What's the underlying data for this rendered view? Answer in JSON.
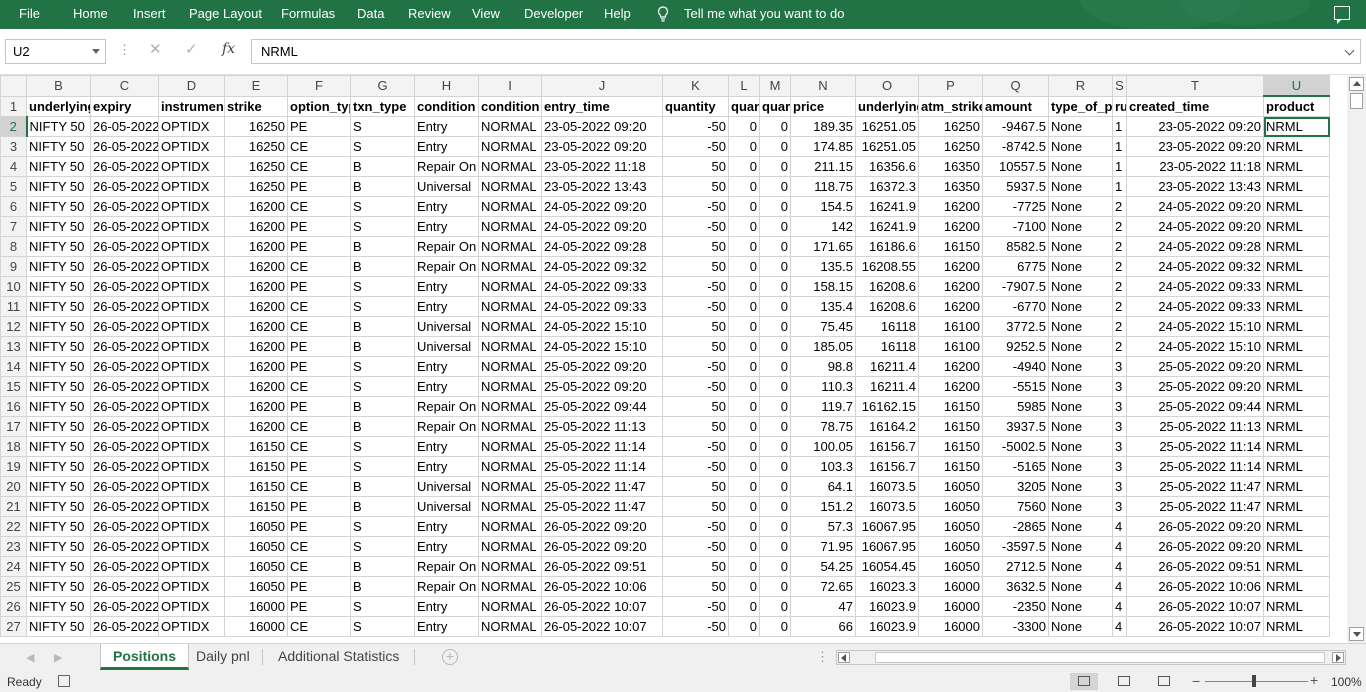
{
  "ribbon": {
    "menus": [
      "File",
      "Home",
      "Insert",
      "Page Layout",
      "Formulas",
      "Data",
      "Review",
      "View",
      "Developer",
      "Help"
    ],
    "tell_me": "Tell me what you want to do"
  },
  "formula_bar": {
    "name_box": "U2",
    "fx": "fx",
    "formula": "NRML"
  },
  "grid": {
    "columns": [
      "B",
      "C",
      "D",
      "E",
      "F",
      "G",
      "H",
      "I",
      "J",
      "K",
      "L",
      "M",
      "N",
      "O",
      "P",
      "Q",
      "R",
      "S",
      "T",
      "U"
    ],
    "selected_column": "U",
    "selected_row": "2",
    "headers": [
      "underlying",
      "expiry",
      "instrument",
      "strike",
      "option_type",
      "txn_type",
      "condition",
      "condition",
      "entry_time",
      "quantity",
      "quan",
      "quar",
      "price",
      "underlying",
      "atm_strike",
      "amount",
      "type_of_p",
      "ru",
      "created_time",
      "product"
    ],
    "rows": [
      [
        "2",
        "NIFTY 50",
        "26-05-2022",
        "OPTIDX",
        "16250",
        "PE",
        "S",
        "Entry",
        "NORMAL",
        "23-05-2022 09:20",
        "-50",
        "0",
        "0",
        "189.35",
        "16251.05",
        "16250",
        "-9467.5",
        "None",
        "1",
        "23-05-2022 09:20",
        "NRML"
      ],
      [
        "3",
        "NIFTY 50",
        "26-05-2022",
        "OPTIDX",
        "16250",
        "CE",
        "S",
        "Entry",
        "NORMAL",
        "23-05-2022 09:20",
        "-50",
        "0",
        "0",
        "174.85",
        "16251.05",
        "16250",
        "-8742.5",
        "None",
        "1",
        "23-05-2022 09:20",
        "NRML"
      ],
      [
        "4",
        "NIFTY 50",
        "26-05-2022",
        "OPTIDX",
        "16250",
        "CE",
        "B",
        "Repair On",
        "NORMAL",
        "23-05-2022 11:18",
        "50",
        "0",
        "0",
        "211.15",
        "16356.6",
        "16350",
        "10557.5",
        "None",
        "1",
        "23-05-2022 11:18",
        "NRML"
      ],
      [
        "5",
        "NIFTY 50",
        "26-05-2022",
        "OPTIDX",
        "16250",
        "PE",
        "B",
        "Universal",
        "NORMAL",
        "23-05-2022 13:43",
        "50",
        "0",
        "0",
        "118.75",
        "16372.3",
        "16350",
        "5937.5",
        "None",
        "1",
        "23-05-2022 13:43",
        "NRML"
      ],
      [
        "6",
        "NIFTY 50",
        "26-05-2022",
        "OPTIDX",
        "16200",
        "CE",
        "S",
        "Entry",
        "NORMAL",
        "24-05-2022 09:20",
        "-50",
        "0",
        "0",
        "154.5",
        "16241.9",
        "16200",
        "-7725",
        "None",
        "2",
        "24-05-2022 09:20",
        "NRML"
      ],
      [
        "7",
        "NIFTY 50",
        "26-05-2022",
        "OPTIDX",
        "16200",
        "PE",
        "S",
        "Entry",
        "NORMAL",
        "24-05-2022 09:20",
        "-50",
        "0",
        "0",
        "142",
        "16241.9",
        "16200",
        "-7100",
        "None",
        "2",
        "24-05-2022 09:20",
        "NRML"
      ],
      [
        "8",
        "NIFTY 50",
        "26-05-2022",
        "OPTIDX",
        "16200",
        "PE",
        "B",
        "Repair On",
        "NORMAL",
        "24-05-2022 09:28",
        "50",
        "0",
        "0",
        "171.65",
        "16186.6",
        "16150",
        "8582.5",
        "None",
        "2",
        "24-05-2022 09:28",
        "NRML"
      ],
      [
        "9",
        "NIFTY 50",
        "26-05-2022",
        "OPTIDX",
        "16200",
        "CE",
        "B",
        "Repair On",
        "NORMAL",
        "24-05-2022 09:32",
        "50",
        "0",
        "0",
        "135.5",
        "16208.55",
        "16200",
        "6775",
        "None",
        "2",
        "24-05-2022 09:32",
        "NRML"
      ],
      [
        "10",
        "NIFTY 50",
        "26-05-2022",
        "OPTIDX",
        "16200",
        "PE",
        "S",
        "Entry",
        "NORMAL",
        "24-05-2022 09:33",
        "-50",
        "0",
        "0",
        "158.15",
        "16208.6",
        "16200",
        "-7907.5",
        "None",
        "2",
        "24-05-2022 09:33",
        "NRML"
      ],
      [
        "11",
        "NIFTY 50",
        "26-05-2022",
        "OPTIDX",
        "16200",
        "CE",
        "S",
        "Entry",
        "NORMAL",
        "24-05-2022 09:33",
        "-50",
        "0",
        "0",
        "135.4",
        "16208.6",
        "16200",
        "-6770",
        "None",
        "2",
        "24-05-2022 09:33",
        "NRML"
      ],
      [
        "12",
        "NIFTY 50",
        "26-05-2022",
        "OPTIDX",
        "16200",
        "CE",
        "B",
        "Universal",
        "NORMAL",
        "24-05-2022 15:10",
        "50",
        "0",
        "0",
        "75.45",
        "16118",
        "16100",
        "3772.5",
        "None",
        "2",
        "24-05-2022 15:10",
        "NRML"
      ],
      [
        "13",
        "NIFTY 50",
        "26-05-2022",
        "OPTIDX",
        "16200",
        "PE",
        "B",
        "Universal",
        "NORMAL",
        "24-05-2022 15:10",
        "50",
        "0",
        "0",
        "185.05",
        "16118",
        "16100",
        "9252.5",
        "None",
        "2",
        "24-05-2022 15:10",
        "NRML"
      ],
      [
        "14",
        "NIFTY 50",
        "26-05-2022",
        "OPTIDX",
        "16200",
        "PE",
        "S",
        "Entry",
        "NORMAL",
        "25-05-2022 09:20",
        "-50",
        "0",
        "0",
        "98.8",
        "16211.4",
        "16200",
        "-4940",
        "None",
        "3",
        "25-05-2022 09:20",
        "NRML"
      ],
      [
        "15",
        "NIFTY 50",
        "26-05-2022",
        "OPTIDX",
        "16200",
        "CE",
        "S",
        "Entry",
        "NORMAL",
        "25-05-2022 09:20",
        "-50",
        "0",
        "0",
        "110.3",
        "16211.4",
        "16200",
        "-5515",
        "None",
        "3",
        "25-05-2022 09:20",
        "NRML"
      ],
      [
        "16",
        "NIFTY 50",
        "26-05-2022",
        "OPTIDX",
        "16200",
        "PE",
        "B",
        "Repair On",
        "NORMAL",
        "25-05-2022 09:44",
        "50",
        "0",
        "0",
        "119.7",
        "16162.15",
        "16150",
        "5985",
        "None",
        "3",
        "25-05-2022 09:44",
        "NRML"
      ],
      [
        "17",
        "NIFTY 50",
        "26-05-2022",
        "OPTIDX",
        "16200",
        "CE",
        "B",
        "Repair On",
        "NORMAL",
        "25-05-2022 11:13",
        "50",
        "0",
        "0",
        "78.75",
        "16164.2",
        "16150",
        "3937.5",
        "None",
        "3",
        "25-05-2022 11:13",
        "NRML"
      ],
      [
        "18",
        "NIFTY 50",
        "26-05-2022",
        "OPTIDX",
        "16150",
        "CE",
        "S",
        "Entry",
        "NORMAL",
        "25-05-2022 11:14",
        "-50",
        "0",
        "0",
        "100.05",
        "16156.7",
        "16150",
        "-5002.5",
        "None",
        "3",
        "25-05-2022 11:14",
        "NRML"
      ],
      [
        "19",
        "NIFTY 50",
        "26-05-2022",
        "OPTIDX",
        "16150",
        "PE",
        "S",
        "Entry",
        "NORMAL",
        "25-05-2022 11:14",
        "-50",
        "0",
        "0",
        "103.3",
        "16156.7",
        "16150",
        "-5165",
        "None",
        "3",
        "25-05-2022 11:14",
        "NRML"
      ],
      [
        "20",
        "NIFTY 50",
        "26-05-2022",
        "OPTIDX",
        "16150",
        "CE",
        "B",
        "Universal",
        "NORMAL",
        "25-05-2022 11:47",
        "50",
        "0",
        "0",
        "64.1",
        "16073.5",
        "16050",
        "3205",
        "None",
        "3",
        "25-05-2022 11:47",
        "NRML"
      ],
      [
        "21",
        "NIFTY 50",
        "26-05-2022",
        "OPTIDX",
        "16150",
        "PE",
        "B",
        "Universal",
        "NORMAL",
        "25-05-2022 11:47",
        "50",
        "0",
        "0",
        "151.2",
        "16073.5",
        "16050",
        "7560",
        "None",
        "3",
        "25-05-2022 11:47",
        "NRML"
      ],
      [
        "22",
        "NIFTY 50",
        "26-05-2022",
        "OPTIDX",
        "16050",
        "PE",
        "S",
        "Entry",
        "NORMAL",
        "26-05-2022 09:20",
        "-50",
        "0",
        "0",
        "57.3",
        "16067.95",
        "16050",
        "-2865",
        "None",
        "4",
        "26-05-2022 09:20",
        "NRML"
      ],
      [
        "23",
        "NIFTY 50",
        "26-05-2022",
        "OPTIDX",
        "16050",
        "CE",
        "S",
        "Entry",
        "NORMAL",
        "26-05-2022 09:20",
        "-50",
        "0",
        "0",
        "71.95",
        "16067.95",
        "16050",
        "-3597.5",
        "None",
        "4",
        "26-05-2022 09:20",
        "NRML"
      ],
      [
        "24",
        "NIFTY 50",
        "26-05-2022",
        "OPTIDX",
        "16050",
        "CE",
        "B",
        "Repair On",
        "NORMAL",
        "26-05-2022 09:51",
        "50",
        "0",
        "0",
        "54.25",
        "16054.45",
        "16050",
        "2712.5",
        "None",
        "4",
        "26-05-2022 09:51",
        "NRML"
      ],
      [
        "25",
        "NIFTY 50",
        "26-05-2022",
        "OPTIDX",
        "16050",
        "PE",
        "B",
        "Repair On",
        "NORMAL",
        "26-05-2022 10:06",
        "50",
        "0",
        "0",
        "72.65",
        "16023.3",
        "16000",
        "3632.5",
        "None",
        "4",
        "26-05-2022 10:06",
        "NRML"
      ],
      [
        "26",
        "NIFTY 50",
        "26-05-2022",
        "OPTIDX",
        "16000",
        "PE",
        "S",
        "Entry",
        "NORMAL",
        "26-05-2022 10:07",
        "-50",
        "0",
        "0",
        "47",
        "16023.9",
        "16000",
        "-2350",
        "None",
        "4",
        "26-05-2022 10:07",
        "NRML"
      ],
      [
        "27",
        "NIFTY 50",
        "26-05-2022",
        "OPTIDX",
        "16000",
        "CE",
        "S",
        "Entry",
        "NORMAL",
        "26-05-2022 10:07",
        "-50",
        "0",
        "0",
        "66",
        "16023.9",
        "16000",
        "-3300",
        "None",
        "4",
        "26-05-2022 10:07",
        "NRML"
      ]
    ]
  },
  "sheets": {
    "tabs": [
      "Positions",
      "Daily pnl",
      "Additional Statistics"
    ],
    "active": "Positions"
  },
  "status": {
    "mode": "Ready",
    "zoom": "100%"
  },
  "colors": {
    "accent": "#217346"
  }
}
